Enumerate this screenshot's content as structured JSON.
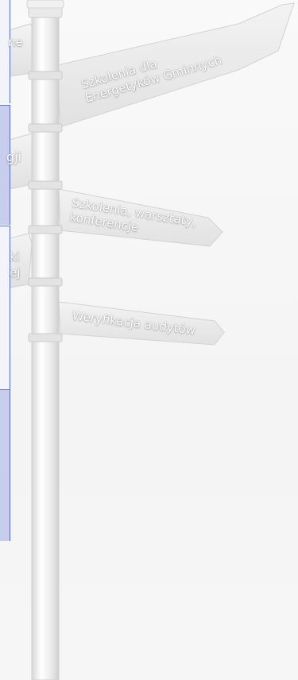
{
  "signpost": {
    "signs": [
      {
        "lines": [
          "Szkolenia dla",
          "Energetyków Gminnych"
        ]
      },
      {
        "lines": [
          "Szkolenia, warsztaty,",
          "konferencje"
        ]
      },
      {
        "lines": [
          "Weryfikacja audytów"
        ]
      }
    ],
    "left_fragments": [
      "ne",
      "gji",
      "ki",
      "ej"
    ]
  },
  "menu": {
    "border_color": "#5a6cc0",
    "active_color": "#c8cdeb"
  }
}
